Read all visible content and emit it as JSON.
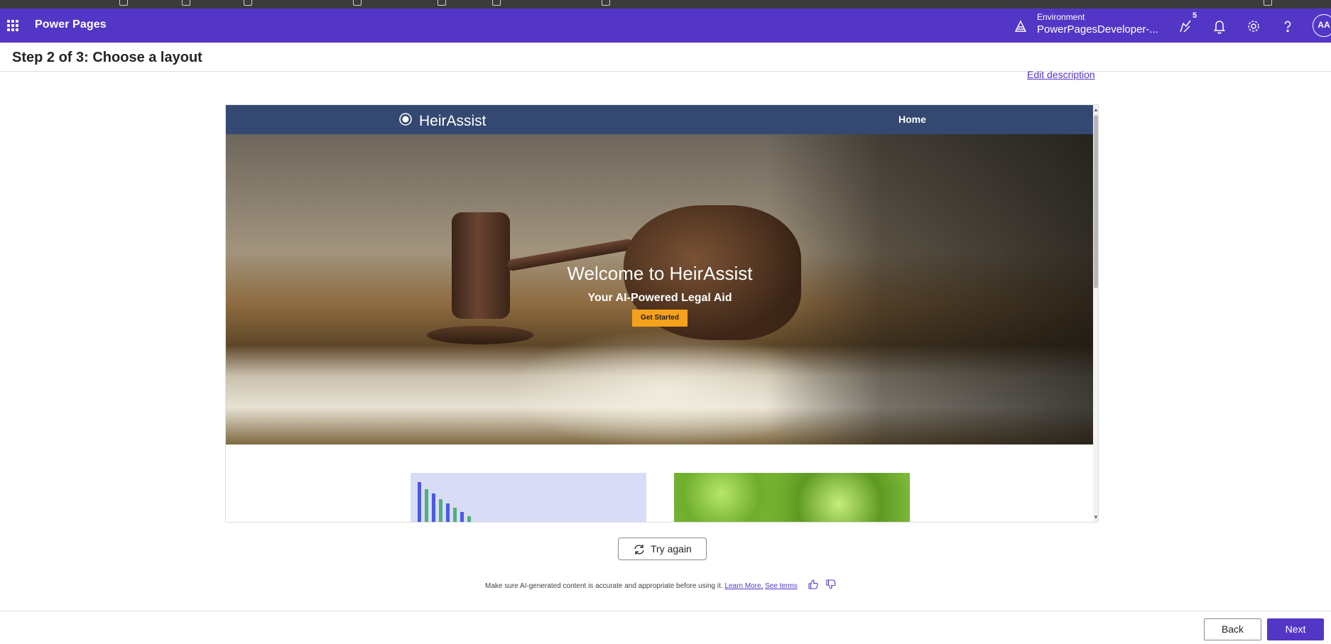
{
  "app": {
    "title": "Power Pages"
  },
  "header": {
    "environment_label": "Environment",
    "environment_value": "PowerPagesDeveloper-...",
    "notification_count": "5",
    "avatar_initials": "AA"
  },
  "step": {
    "title": "Step 2 of 3: Choose a layout",
    "edit_description": "Edit description"
  },
  "preview": {
    "brand": "HeirAssist",
    "nav_home": "Home",
    "hero_title": "Welcome to HeirAssist",
    "hero_subtitle": "Your AI-Powered Legal Aid",
    "hero_button": "Get Started"
  },
  "actions": {
    "try_again": "Try again",
    "back": "Back",
    "next": "Next"
  },
  "disclaimer": {
    "text": "Make sure AI-generated content is accurate and appropriate before using it.",
    "learn_more": "Learn More,",
    "see_terms": "See terms"
  },
  "colors": {
    "brand": "#5436c6",
    "site_nav": "#344872",
    "hero_button": "#f5a11b"
  },
  "icons": [
    "waffle-icon",
    "environment-icon",
    "copilot-icon",
    "bell-icon",
    "gear-icon",
    "help-icon",
    "refresh-icon",
    "thumbs-up-icon",
    "thumbs-down-icon"
  ]
}
